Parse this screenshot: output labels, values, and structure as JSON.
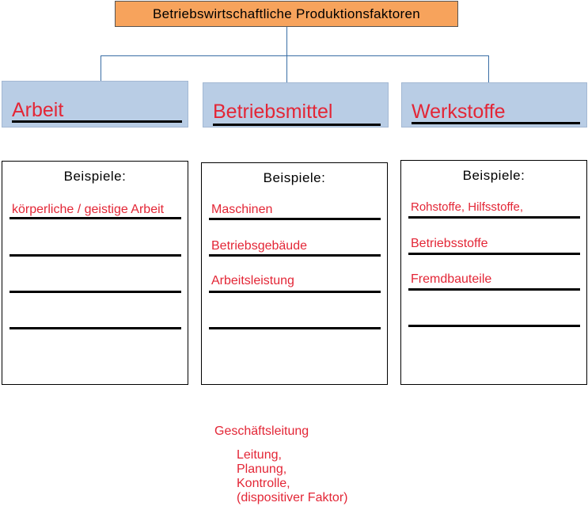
{
  "root": {
    "title": "Betriebswirtschaftliche Produktionsfaktoren"
  },
  "categories": [
    {
      "label": "Arbeit",
      "examples_heading": "Beispiele:",
      "examples": [
        "körperliche / geistige Arbeit",
        "",
        "",
        ""
      ]
    },
    {
      "label": "Betriebsmittel",
      "examples_heading": "Beispiele:",
      "examples": [
        "Maschinen",
        "Betriebsgebäude",
        "Arbeitsleistung",
        ""
      ]
    },
    {
      "label": "Werkstoffe",
      "examples_heading": "Beispiele:",
      "examples": [
        "Rohstoffe, Hilfsstoffe,",
        "Betriebsstoffe",
        "Fremdbauteile",
        ""
      ]
    }
  ],
  "note": {
    "title": "Geschäftsleitung",
    "lines": [
      "Leitung,",
      "Planung,",
      "Kontrolle,",
      "(dispositiver Faktor)"
    ]
  },
  "colors": {
    "root_fill": "#f7a35c",
    "category_fill": "#b9cde5",
    "connector": "#3a6ea5",
    "answer_text": "#e32636"
  }
}
